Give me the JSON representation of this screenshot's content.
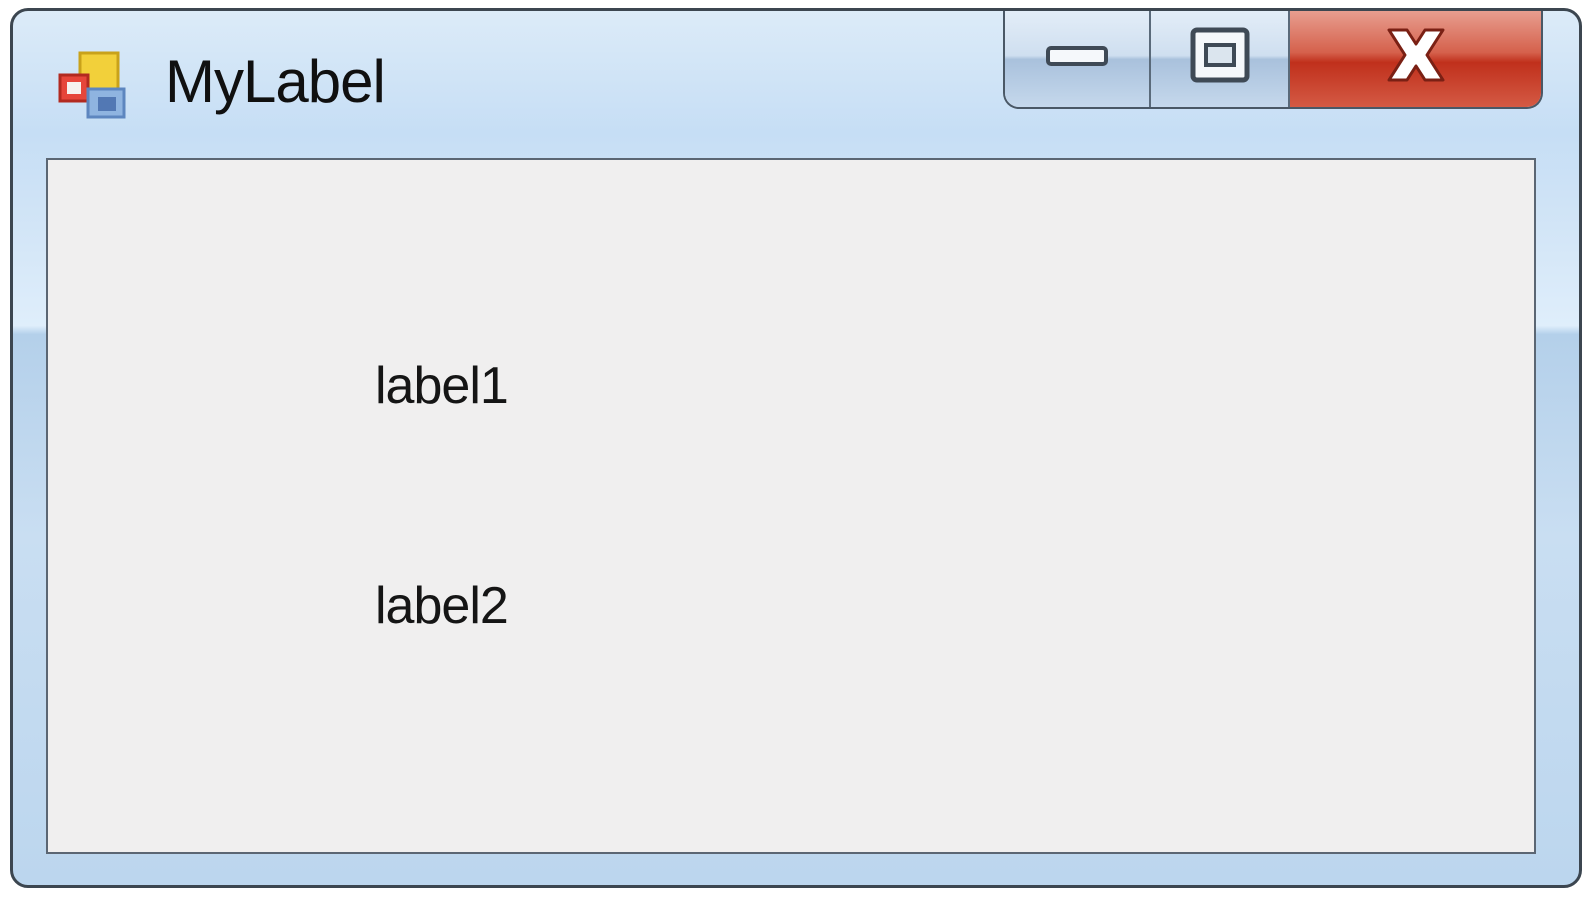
{
  "window": {
    "title": "MyLabel",
    "icon": "winforms-app-icon",
    "caption_buttons": {
      "minimize": "minimize-icon",
      "maximize": "maximize-icon",
      "close": "close-icon"
    },
    "colors": {
      "frame": "#c6def5",
      "close_button": "#c0301c",
      "client_background": "#f0efef"
    }
  },
  "form": {
    "labels": [
      {
        "text": "label1"
      },
      {
        "text": "label2"
      }
    ]
  }
}
